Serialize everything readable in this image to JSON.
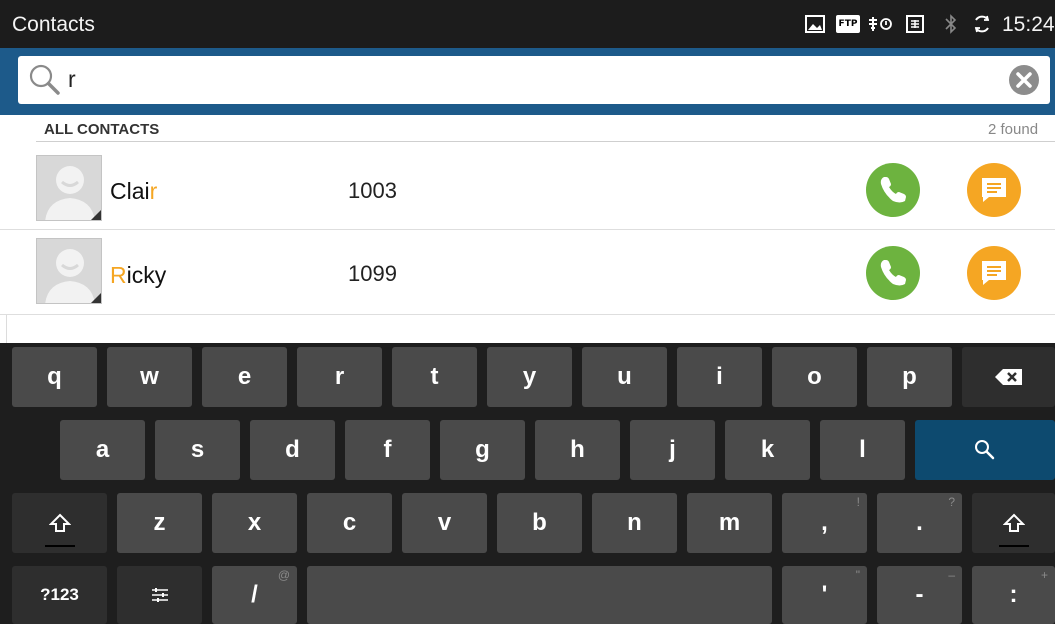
{
  "status_bar": {
    "app_title": "Contacts",
    "time": "15:24",
    "icons": [
      "gallery-icon",
      "ftp-icon",
      "usb-debug-icon",
      "sim-card-icon",
      "bluetooth-icon",
      "sync-icon"
    ],
    "ftp_label": "FTP"
  },
  "search": {
    "query": "r",
    "clear_icon": "close-circle-icon"
  },
  "results": {
    "section_label": "ALL CONTACTS",
    "count_label": "2 found",
    "contacts": [
      {
        "name_pre": "Clai",
        "name_match": "r",
        "name_post": "",
        "number": "1003"
      },
      {
        "name_pre": "",
        "name_match": "R",
        "name_post": "icky",
        "number": "1099"
      }
    ]
  },
  "keyboard": {
    "row1": [
      "q",
      "w",
      "e",
      "r",
      "t",
      "y",
      "u",
      "i",
      "o",
      "p"
    ],
    "row2": [
      "a",
      "s",
      "d",
      "f",
      "g",
      "h",
      "j",
      "k",
      "l"
    ],
    "row3": [
      "z",
      "x",
      "c",
      "v",
      "b",
      "n",
      "m",
      ",",
      "."
    ],
    "row3_alts": {
      "comma": "!",
      "period": "?"
    },
    "row4": {
      "mode": "?123",
      "slash": "/",
      "slash_alt": "@",
      "apostrophe": "'",
      "apostrophe_alt": "\"",
      "dash": "-",
      "dash_alt": "–",
      "colon": ":",
      "colon_alt": "+"
    }
  },
  "colors": {
    "accent": "#1d5a8a",
    "call": "#6db33f",
    "message": "#f5a623",
    "highlight": "#f5a623",
    "search_key": "#0d4a6f"
  }
}
